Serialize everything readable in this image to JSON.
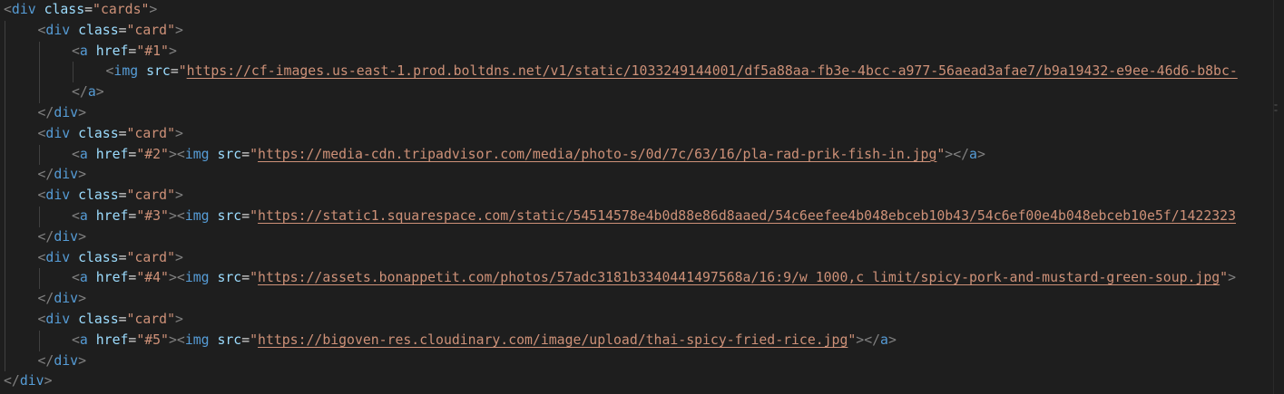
{
  "editor": {
    "language": "html",
    "lines": [
      {
        "indent": 0,
        "tokens": [
          [
            "brk",
            "<"
          ],
          [
            "tag",
            "div"
          ],
          [
            "sp",
            " "
          ],
          [
            "attr",
            "class"
          ],
          [
            "eq",
            "="
          ],
          [
            "str",
            "\"cards\""
          ],
          [
            "brk",
            ">"
          ]
        ]
      },
      {
        "indent": 1,
        "tokens": [
          [
            "brk",
            "<"
          ],
          [
            "tag",
            "div"
          ],
          [
            "sp",
            " "
          ],
          [
            "attr",
            "class"
          ],
          [
            "eq",
            "="
          ],
          [
            "str",
            "\"card\""
          ],
          [
            "brk",
            ">"
          ]
        ]
      },
      {
        "indent": 2,
        "tokens": [
          [
            "brk",
            "<"
          ],
          [
            "tag",
            "a"
          ],
          [
            "sp",
            " "
          ],
          [
            "attr",
            "href"
          ],
          [
            "eq",
            "="
          ],
          [
            "str",
            "\"#1\""
          ],
          [
            "brk",
            ">"
          ]
        ]
      },
      {
        "indent": 3,
        "tokens": [
          [
            "brk",
            "<"
          ],
          [
            "tag",
            "img"
          ],
          [
            "sp",
            " "
          ],
          [
            "attr",
            "src"
          ],
          [
            "eq",
            "="
          ],
          [
            "str",
            "\""
          ],
          [
            "url",
            "https://cf-images.us-east-1.prod.boltdns.net/v1/static/1033249144001/df5a88aa-fb3e-4bcc-a977-56aead3afae7/b9a19432-e9ee-46d6-b8bc-"
          ]
        ]
      },
      {
        "indent": 2,
        "tokens": [
          [
            "brk",
            "</"
          ],
          [
            "tag",
            "a"
          ],
          [
            "brk",
            ">"
          ]
        ]
      },
      {
        "indent": 1,
        "tokens": [
          [
            "brk",
            "</"
          ],
          [
            "tag",
            "div"
          ],
          [
            "brk",
            ">"
          ]
        ]
      },
      {
        "indent": 1,
        "tokens": [
          [
            "brk",
            "<"
          ],
          [
            "tag",
            "div"
          ],
          [
            "sp",
            " "
          ],
          [
            "attr",
            "class"
          ],
          [
            "eq",
            "="
          ],
          [
            "str",
            "\"card\""
          ],
          [
            "brk",
            ">"
          ]
        ]
      },
      {
        "indent": 2,
        "tokens": [
          [
            "brk",
            "<"
          ],
          [
            "tag",
            "a"
          ],
          [
            "sp",
            " "
          ],
          [
            "attr",
            "href"
          ],
          [
            "eq",
            "="
          ],
          [
            "str",
            "\"#2\""
          ],
          [
            "brk",
            ">"
          ],
          [
            "brk",
            "<"
          ],
          [
            "tag",
            "img"
          ],
          [
            "sp",
            " "
          ],
          [
            "attr",
            "src"
          ],
          [
            "eq",
            "="
          ],
          [
            "str",
            "\""
          ],
          [
            "url",
            "https://media-cdn.tripadvisor.com/media/photo-s/0d/7c/63/16/pla-rad-prik-fish-in.jpg"
          ],
          [
            "str",
            "\""
          ],
          [
            "brk",
            "></"
          ],
          [
            "tag",
            "a"
          ],
          [
            "brk",
            ">"
          ]
        ]
      },
      {
        "indent": 1,
        "tokens": [
          [
            "brk",
            "</"
          ],
          [
            "tag",
            "div"
          ],
          [
            "brk",
            ">"
          ]
        ]
      },
      {
        "indent": 1,
        "tokens": [
          [
            "brk",
            "<"
          ],
          [
            "tag",
            "div"
          ],
          [
            "sp",
            " "
          ],
          [
            "attr",
            "class"
          ],
          [
            "eq",
            "="
          ],
          [
            "str",
            "\"card\""
          ],
          [
            "brk",
            ">"
          ]
        ]
      },
      {
        "indent": 2,
        "tokens": [
          [
            "brk",
            "<"
          ],
          [
            "tag",
            "a"
          ],
          [
            "sp",
            " "
          ],
          [
            "attr",
            "href"
          ],
          [
            "eq",
            "="
          ],
          [
            "str",
            "\"#3\""
          ],
          [
            "brk",
            ">"
          ],
          [
            "brk",
            "<"
          ],
          [
            "tag",
            "img"
          ],
          [
            "sp",
            " "
          ],
          [
            "attr",
            "src"
          ],
          [
            "eq",
            "="
          ],
          [
            "str",
            "\""
          ],
          [
            "url",
            "https://static1.squarespace.com/static/54514578e4b0d88e86d8aaed/54c6eefee4b048ebceb10b43/54c6ef00e4b048ebceb10e5f/1422323"
          ]
        ]
      },
      {
        "indent": 1,
        "tokens": [
          [
            "brk",
            "</"
          ],
          [
            "tag",
            "div"
          ],
          [
            "brk",
            ">"
          ]
        ]
      },
      {
        "indent": 1,
        "tokens": [
          [
            "brk",
            "<"
          ],
          [
            "tag",
            "div"
          ],
          [
            "sp",
            " "
          ],
          [
            "attr",
            "class"
          ],
          [
            "eq",
            "="
          ],
          [
            "str",
            "\"card\""
          ],
          [
            "brk",
            ">"
          ]
        ]
      },
      {
        "indent": 2,
        "tokens": [
          [
            "brk",
            "<"
          ],
          [
            "tag",
            "a"
          ],
          [
            "sp",
            " "
          ],
          [
            "attr",
            "href"
          ],
          [
            "eq",
            "="
          ],
          [
            "str",
            "\"#4\""
          ],
          [
            "brk",
            ">"
          ],
          [
            "brk",
            "<"
          ],
          [
            "tag",
            "img"
          ],
          [
            "sp",
            " "
          ],
          [
            "attr",
            "src"
          ],
          [
            "eq",
            "="
          ],
          [
            "str",
            "\""
          ],
          [
            "url",
            "https://assets.bonappetit.com/photos/57adc3181b3340441497568a/16:9/w_1000,c_limit/spicy-pork-and-mustard-green-soup.jpg"
          ],
          [
            "str",
            "\""
          ],
          [
            "brk",
            ">"
          ]
        ]
      },
      {
        "indent": 1,
        "tokens": [
          [
            "brk",
            "</"
          ],
          [
            "tag",
            "div"
          ],
          [
            "brk",
            ">"
          ]
        ]
      },
      {
        "indent": 1,
        "tokens": [
          [
            "brk",
            "<"
          ],
          [
            "tag",
            "div"
          ],
          [
            "sp",
            " "
          ],
          [
            "attr",
            "class"
          ],
          [
            "eq",
            "="
          ],
          [
            "str",
            "\"card\""
          ],
          [
            "brk",
            ">"
          ]
        ]
      },
      {
        "indent": 2,
        "tokens": [
          [
            "brk",
            "<"
          ],
          [
            "tag",
            "a"
          ],
          [
            "sp",
            " "
          ],
          [
            "attr",
            "href"
          ],
          [
            "eq",
            "="
          ],
          [
            "str",
            "\"#5\""
          ],
          [
            "brk",
            ">"
          ],
          [
            "brk",
            "<"
          ],
          [
            "tag",
            "img"
          ],
          [
            "sp",
            " "
          ],
          [
            "attr",
            "src"
          ],
          [
            "eq",
            "="
          ],
          [
            "str",
            "\""
          ],
          [
            "url",
            "https://bigoven-res.cloudinary.com/image/upload/thai-spicy-fried-rice.jpg"
          ],
          [
            "str",
            "\""
          ],
          [
            "brk",
            "></"
          ],
          [
            "tag",
            "a"
          ],
          [
            "brk",
            ">"
          ]
        ]
      },
      {
        "indent": 1,
        "tokens": [
          [
            "brk",
            "</"
          ],
          [
            "tag",
            "div"
          ],
          [
            "brk",
            ">"
          ]
        ]
      },
      {
        "indent": 0,
        "tokens": [
          [
            "brk",
            "</"
          ],
          [
            "tag",
            "div"
          ],
          [
            "brk",
            ">"
          ]
        ]
      }
    ]
  },
  "colors": {
    "background": "#1e1e1e",
    "tag": "#569cd6",
    "bracket": "#808080",
    "attribute": "#9cdcfe",
    "string": "#ce9178",
    "text": "#d4d4d4",
    "indent_guide": "#404040"
  }
}
